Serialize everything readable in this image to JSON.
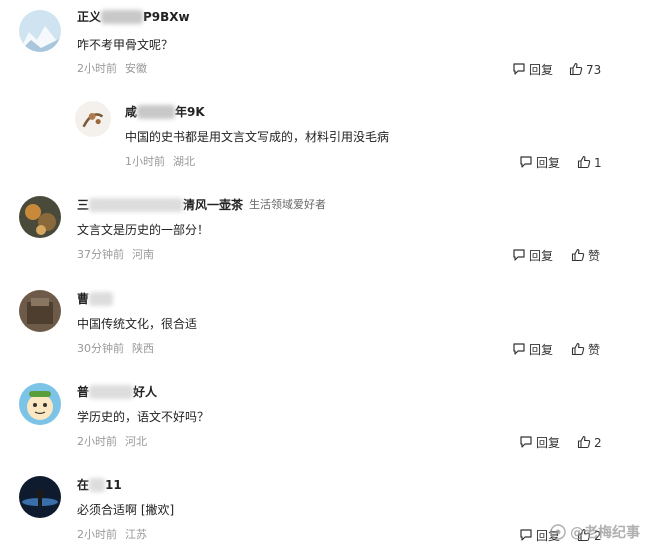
{
  "comments": [
    {
      "name_prefix": "正义",
      "name_suffix": "P9BXw",
      "badge": "",
      "text": "咋不考甲骨文呢？",
      "time": "2小时前",
      "location": "安徽",
      "reply_label": "回复",
      "like_count": "73"
    },
    {
      "name_prefix": "咸",
      "name_suffix": "年9K",
      "badge": "",
      "text": "中国的史书都是用文言文写成的，材料引用没毛病",
      "time": "1小时前",
      "location": "湖北",
      "reply_label": "回复",
      "like_count": "1"
    },
    {
      "name_prefix": "三",
      "name_suffix": "清风一壶茶",
      "badge": "生活领域爱好者",
      "text": "文言文是历史的一部分！",
      "time": "37分钟前",
      "location": "河南",
      "reply_label": "回复",
      "like_count": "赞"
    },
    {
      "name_prefix": "曹",
      "name_suffix": "",
      "badge": "",
      "text": "中国传统文化，很合适",
      "time": "30分钟前",
      "location": "陕西",
      "reply_label": "回复",
      "like_count": "赞"
    },
    {
      "name_prefix": "普",
      "name_suffix": "好人",
      "badge": "",
      "text": "学历史的，语文不好吗？",
      "time": "2小时前",
      "location": "河北",
      "reply_label": "回复",
      "like_count": "2"
    },
    {
      "name_prefix": "在",
      "name_suffix": "11",
      "badge": "",
      "text": "必须合适啊 [撇欢]",
      "time": "2小时前",
      "location": "江苏",
      "reply_label": "回复",
      "like_count": "2"
    }
  ],
  "watermark": "@老梅纪事",
  "icons": {
    "reply": "speech-bubble-icon",
    "like": "thumbs-up-icon"
  }
}
